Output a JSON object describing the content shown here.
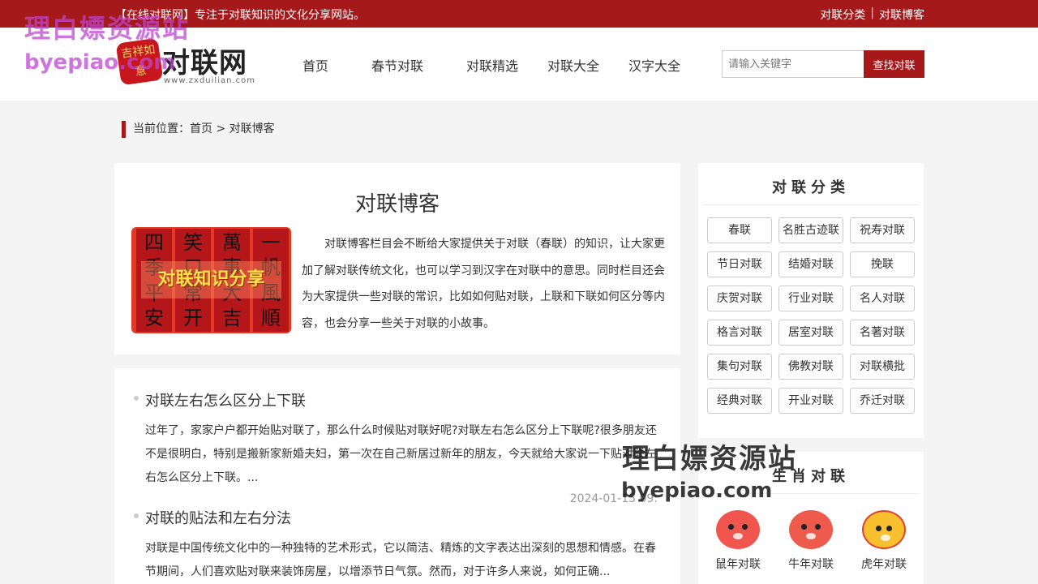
{
  "topbar": {
    "tagline": "【在线对联网】专注于对联知识的文化分享网站。",
    "links": [
      "对联分类",
      "对联博客"
    ],
    "separator": "|"
  },
  "logo": {
    "seal_text": "吉祥如意",
    "name": "对联网",
    "url": "www.zxduilian.com"
  },
  "nav": [
    "首页",
    "春节对联",
    "对联精选",
    "对联大全",
    "汉字大全"
  ],
  "search": {
    "placeholder": "请输入关键字",
    "button": "查找对联"
  },
  "breadcrumb": "当前位置：首页 > 对联博客",
  "intro": {
    "title": "对联博客",
    "banner_strips": [
      "四季平安",
      "笑口常开",
      "萬事大吉",
      "一帆風順"
    ],
    "banner_caption": "对联知识分享",
    "text": "对联博客栏目会不断给大家提供关于对联（春联）的知识，让大家更加了解对联传统文化，也可以学习到汉字在对联中的意思。同时栏目还会为大家提供一些对联的常识，比如如何贴对联，上联和下联如何区分等内容，也会分享一些关于对联的小故事。"
  },
  "posts": [
    {
      "title": "对联左右怎么区分上下联",
      "excerpt": "过年了，家家户户都开始贴对联了，那么什么时候贴对联好呢?对联左右怎么区分上下联呢?很多朋友还不是很明白，特别是搬新家新婚夫妇，第一次在自己新居过新年的朋友，今天就给大家说一下贴对联左右怎么区分上下联。...",
      "date": "2024-01-15 09:"
    },
    {
      "title": "对联的贴法和左右分法",
      "excerpt": "对联是中国传统文化中的一种独特的艺术形式，它以简洁、精炼的文字表达出深刻的思想和情感。在春节期间，人们喜欢贴对联来装饰房屋，以增添节日气氛。然而，对于许多人来说，如何正确...",
      "date": ""
    }
  ],
  "categories": {
    "title": "对联分类",
    "items": [
      "春联",
      "名胜古迹联",
      "祝寿对联",
      "节日对联",
      "结婚对联",
      "挽联",
      "庆贺对联",
      "行业对联",
      "名人对联",
      "格言对联",
      "居室对联",
      "名著对联",
      "集句对联",
      "佛教对联",
      "对联横批",
      "经典对联",
      "开业对联",
      "乔迁对联"
    ]
  },
  "zodiac": {
    "title": "生肖对联",
    "items": [
      {
        "label": "鼠年对联",
        "icon": "rat-icon"
      },
      {
        "label": "牛年对联",
        "icon": "ox-icon"
      },
      {
        "label": "虎年对联",
        "icon": "tiger-icon"
      }
    ]
  },
  "watermark": {
    "cn": "理白嫖资源站",
    "url": "byepiao.com",
    "cn2": "理白嫖资源站",
    "url2": "byepiao.com"
  },
  "colors": {
    "brand": "#a5191b",
    "background": "#f4f4f4"
  }
}
